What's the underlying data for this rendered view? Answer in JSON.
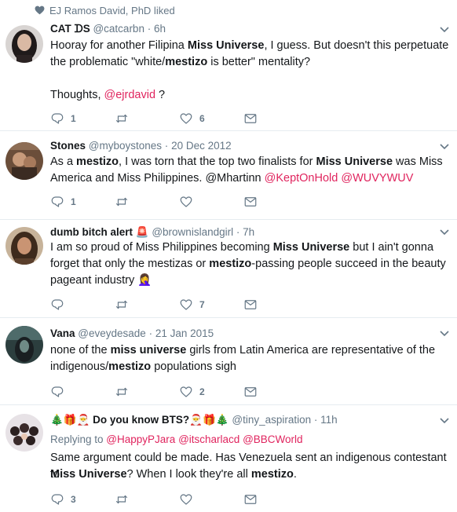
{
  "liked_bar": {
    "text": "EJ Ramos David, PhD liked"
  },
  "tweets": [
    {
      "name": "CAT ᗪS",
      "handle": "@catcarbn",
      "time": "6h",
      "lines": [
        [
          {
            "t": "Hooray for another Filipina "
          },
          {
            "t": "Miss Universe",
            "b": true
          },
          {
            "t": ", I guess. But doesn't this perpetuate"
          }
        ],
        [
          {
            "t": "the problematic \"white/"
          },
          {
            "t": "mestizo",
            "b": true
          },
          {
            "t": " is better\" mentality?"
          }
        ],
        [],
        [
          {
            "t": "Thoughts, "
          },
          {
            "t": "@ejrdavid",
            "m": true
          },
          {
            "t": " ?"
          }
        ]
      ],
      "actions": {
        "reply": "1",
        "retweet": "",
        "like": "6"
      }
    },
    {
      "name": "Stones",
      "handle": "@myboystones",
      "time": "20 Dec 2012",
      "lines": [
        [
          {
            "t": "As a "
          },
          {
            "t": "mestizo",
            "b": true
          },
          {
            "t": ", I was torn that the top two finalists for "
          },
          {
            "t": "Miss Universe",
            "b": true
          },
          {
            "t": " was Miss"
          }
        ],
        [
          {
            "t": "America and Miss Philippines. @Mhartinn "
          },
          {
            "t": "@KeptOnHold",
            "m": true
          },
          {
            "t": " "
          },
          {
            "t": "@WUVYWUV",
            "m": true
          }
        ]
      ],
      "actions": {
        "reply": "1",
        "retweet": "",
        "like": ""
      }
    },
    {
      "name": "dumb bitch alert 🚨",
      "handle": "@brownislandgirl",
      "time": "7h",
      "lines": [
        [
          {
            "t": "I am so proud of Miss Philippines becoming "
          },
          {
            "t": "Miss Universe",
            "b": true
          },
          {
            "t": " but I ain't gonna"
          }
        ],
        [
          {
            "t": "forget that only the mestizas or "
          },
          {
            "t": "mestizo",
            "b": true
          },
          {
            "t": "-passing people succeed in the beauty"
          }
        ],
        [
          {
            "t": "pageant industry 🤦‍♀️"
          }
        ]
      ],
      "actions": {
        "reply": "",
        "retweet": "",
        "like": "7"
      }
    },
    {
      "name": "Vana",
      "handle": "@eveydesade",
      "time": "21 Jan 2015",
      "lines": [
        [
          {
            "t": "none of the "
          },
          {
            "t": "miss universe",
            "b": true
          },
          {
            "t": " girls from Latin America are representative of the"
          }
        ],
        [
          {
            "t": "indigenous/"
          },
          {
            "t": "mestizo",
            "b": true
          },
          {
            "t": " populations sigh"
          }
        ]
      ],
      "actions": {
        "reply": "",
        "retweet": "",
        "like": "2"
      }
    },
    {
      "name": "🎄🎁🎅 Do you know BTS?🎅🎁🎄",
      "handle": "@tiny_aspiration",
      "time": "11h",
      "reply_prefix": "Replying to ",
      "reply_mentions": [
        "@HappyPJara",
        "@itscharlacd",
        "@BBCWorld"
      ],
      "lines": [
        [
          {
            "t": "Same argument could be made. Has Venezuela sent an indigenous contestant to"
          }
        ],
        [
          {
            "t": "Miss Universe",
            "b": true
          },
          {
            "t": "? When I look they're all "
          },
          {
            "t": "mestizo",
            "b": true
          },
          {
            "t": "."
          }
        ]
      ],
      "actions": {
        "reply": "3",
        "retweet": "",
        "like": ""
      }
    }
  ],
  "dot": "·",
  "icons": {
    "liked": "heart-icon",
    "reply": "reply-icon",
    "retweet": "retweet-icon",
    "like": "like-icon",
    "dm": "mail-icon",
    "more": "chevron-down-icon"
  },
  "colors": {
    "text": "#14171a",
    "muted": "#657786",
    "mention": "#e0245e",
    "icon": "#657786",
    "separator": "#e6ecf0"
  }
}
